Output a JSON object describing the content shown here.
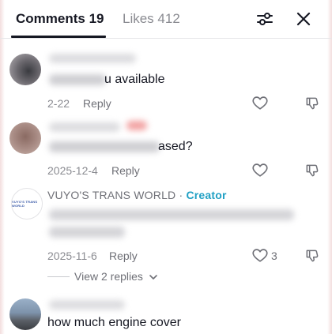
{
  "header": {
    "tabs": [
      {
        "label": "Comments 19",
        "active": true
      },
      {
        "label": "Likes 412",
        "active": false
      }
    ],
    "filter_icon": "sliders-icon",
    "close_icon": "close-icon"
  },
  "comments": [
    {
      "text": "u available",
      "date": "2-22",
      "reply_label": "Reply",
      "like_count": ""
    },
    {
      "text": "ased?",
      "date": "2025-12-4",
      "reply_label": "Reply",
      "like_count": ""
    },
    {
      "username": "VUYO'S TRANS WORLD",
      "separator": "·",
      "badge": "Creator",
      "avatar_logo_text": "VUYO'S TRANS WORLD",
      "date": "2025-11-6",
      "reply_label": "Reply",
      "like_count": "3",
      "view_replies": "View 2 replies"
    },
    {
      "text": "how much engine cover"
    }
  ],
  "colors": {
    "text_primary": "#161823",
    "text_secondary": "#8a8b91",
    "creator_badge": "#20a0c4",
    "divider": "#e6e6e8"
  }
}
